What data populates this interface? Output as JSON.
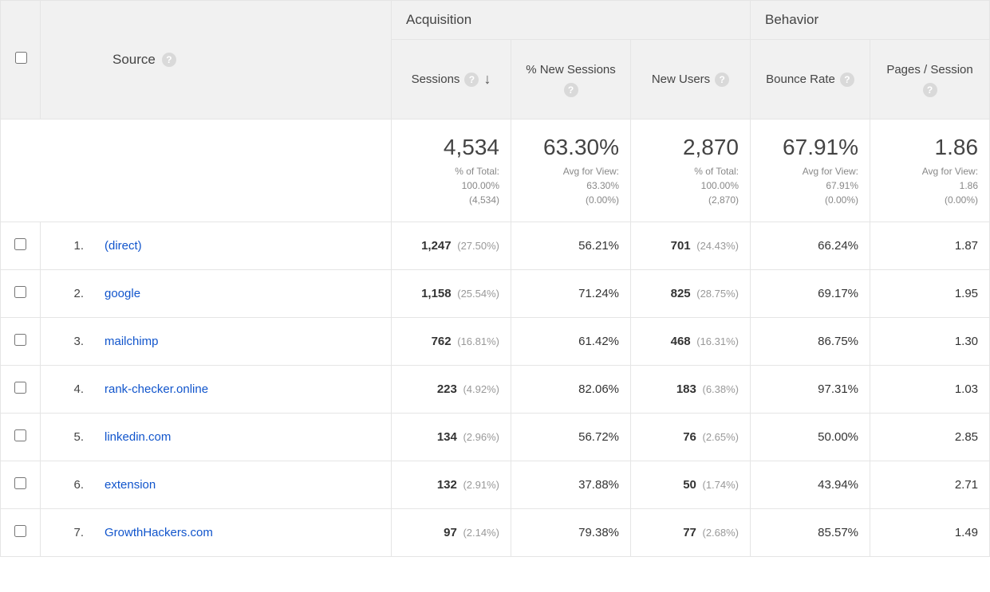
{
  "headers": {
    "dimension": "Source",
    "groups": {
      "acquisition": "Acquisition",
      "behavior": "Behavior"
    },
    "metrics": {
      "sessions": "Sessions",
      "pct_new_sessions": "% New Sessions",
      "new_users": "New Users",
      "bounce_rate": "Bounce Rate",
      "pages_per_session": "Pages / Session"
    }
  },
  "summary": {
    "sessions": {
      "value": "4,534",
      "sub1": "% of Total:",
      "sub2": "100.00%",
      "sub3": "(4,534)"
    },
    "pct_new_sessions": {
      "value": "63.30%",
      "sub1": "Avg for View:",
      "sub2": "63.30%",
      "sub3": "(0.00%)"
    },
    "new_users": {
      "value": "2,870",
      "sub1": "% of Total:",
      "sub2": "100.00%",
      "sub3": "(2,870)"
    },
    "bounce_rate": {
      "value": "67.91%",
      "sub1": "Avg for View:",
      "sub2": "67.91%",
      "sub3": "(0.00%)"
    },
    "pages_per_session": {
      "value": "1.86",
      "sub1": "Avg for View:",
      "sub2": "1.86",
      "sub3": "(0.00%)"
    }
  },
  "rows": [
    {
      "index": "1.",
      "source": "(direct)",
      "sessions": "1,247",
      "sessions_pct": "(27.50%)",
      "pct_new": "56.21%",
      "new_users": "701",
      "new_users_pct": "(24.43%)",
      "bounce": "66.24%",
      "pps": "1.87"
    },
    {
      "index": "2.",
      "source": "google",
      "sessions": "1,158",
      "sessions_pct": "(25.54%)",
      "pct_new": "71.24%",
      "new_users": "825",
      "new_users_pct": "(28.75%)",
      "bounce": "69.17%",
      "pps": "1.95"
    },
    {
      "index": "3.",
      "source": "mailchimp",
      "sessions": "762",
      "sessions_pct": "(16.81%)",
      "pct_new": "61.42%",
      "new_users": "468",
      "new_users_pct": "(16.31%)",
      "bounce": "86.75%",
      "pps": "1.30"
    },
    {
      "index": "4.",
      "source": "rank-checker.online",
      "sessions": "223",
      "sessions_pct": "(4.92%)",
      "pct_new": "82.06%",
      "new_users": "183",
      "new_users_pct": "(6.38%)",
      "bounce": "97.31%",
      "pps": "1.03"
    },
    {
      "index": "5.",
      "source": "linkedin.com",
      "sessions": "134",
      "sessions_pct": "(2.96%)",
      "pct_new": "56.72%",
      "new_users": "76",
      "new_users_pct": "(2.65%)",
      "bounce": "50.00%",
      "pps": "2.85"
    },
    {
      "index": "6.",
      "source": "extension",
      "sessions": "132",
      "sessions_pct": "(2.91%)",
      "pct_new": "37.88%",
      "new_users": "50",
      "new_users_pct": "(1.74%)",
      "bounce": "43.94%",
      "pps": "2.71"
    },
    {
      "index": "7.",
      "source": "GrowthHackers.com",
      "sessions": "97",
      "sessions_pct": "(2.14%)",
      "pct_new": "79.38%",
      "new_users": "77",
      "new_users_pct": "(2.68%)",
      "bounce": "85.57%",
      "pps": "1.49"
    }
  ]
}
